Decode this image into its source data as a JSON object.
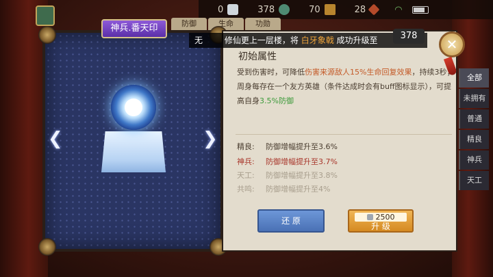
{
  "topbar": {
    "res1": "0",
    "res2": "378",
    "res3": "70",
    "res4": "28"
  },
  "top_tabs": [
    "防御",
    "生命",
    "功勋"
  ],
  "artifact": {
    "name": "神兵.番天印"
  },
  "notice": {
    "pre": "无",
    "text1": "修仙更上一层楼，将",
    "highlight": "白牙象戟",
    "text2": "成功升级至",
    "level": "378"
  },
  "detail": {
    "title": "初始属性",
    "desc_1": "受到伤害时，可降低",
    "desc_orange": "伤害来源敌人15%生命回复效果",
    "desc_2": "，持续3秒；周身每存在一个友方英雄（条件达成时会有buff图标显示），可提高自身",
    "desc_green": "3.5%防御"
  },
  "tiers": [
    {
      "label": "精良:",
      "text": "防御增幅提升至3.6%"
    },
    {
      "label": "神兵:",
      "text": "防御增幅提升至3.7%"
    },
    {
      "label": "天工:",
      "text": "防御增幅提升至3.8%"
    },
    {
      "label": "共鸣:",
      "text": "防御增幅提升至4%"
    }
  ],
  "buttons": {
    "restore": "还 原",
    "upgrade_cost": "2500",
    "upgrade": "升 级"
  },
  "filters": [
    "全部",
    "未拥有",
    "普通",
    "精良",
    "神兵",
    "天工"
  ]
}
